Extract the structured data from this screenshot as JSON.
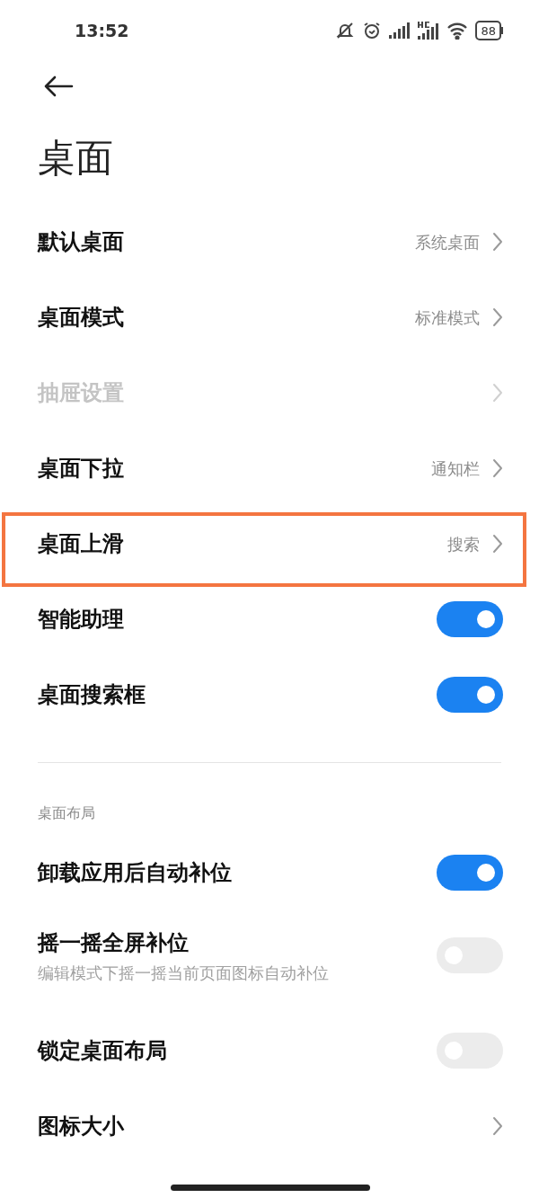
{
  "status_bar": {
    "time": "13:52",
    "battery": "88"
  },
  "title": "桌面",
  "items": [
    {
      "kind": "link",
      "label": "默认桌面",
      "value": "系统桌面",
      "disabled": false,
      "highlighted": false
    },
    {
      "kind": "link",
      "label": "桌面模式",
      "value": "标准模式",
      "disabled": false,
      "highlighted": false
    },
    {
      "kind": "link",
      "label": "抽屉设置",
      "disabled": true,
      "highlighted": false
    },
    {
      "kind": "link",
      "label": "桌面下拉",
      "value": "通知栏",
      "disabled": false,
      "highlighted": false
    },
    {
      "kind": "link",
      "label": "桌面上滑",
      "value": "搜索",
      "disabled": false,
      "highlighted": true
    },
    {
      "kind": "toggle",
      "label": "智能助理",
      "on": true
    },
    {
      "kind": "toggle",
      "label": "桌面搜索框",
      "on": true
    }
  ],
  "section": {
    "header": "桌面布局",
    "items": [
      {
        "kind": "toggle",
        "label": "卸载应用后自动补位",
        "on": true
      },
      {
        "kind": "toggle",
        "label": "摇一摇全屏补位",
        "subtitle": "编辑模式下摇一摇当前页面图标自动补位",
        "on": false
      },
      {
        "kind": "toggle",
        "label": "锁定桌面布局",
        "on": false
      },
      {
        "kind": "link",
        "label": "图标大小"
      }
    ]
  }
}
